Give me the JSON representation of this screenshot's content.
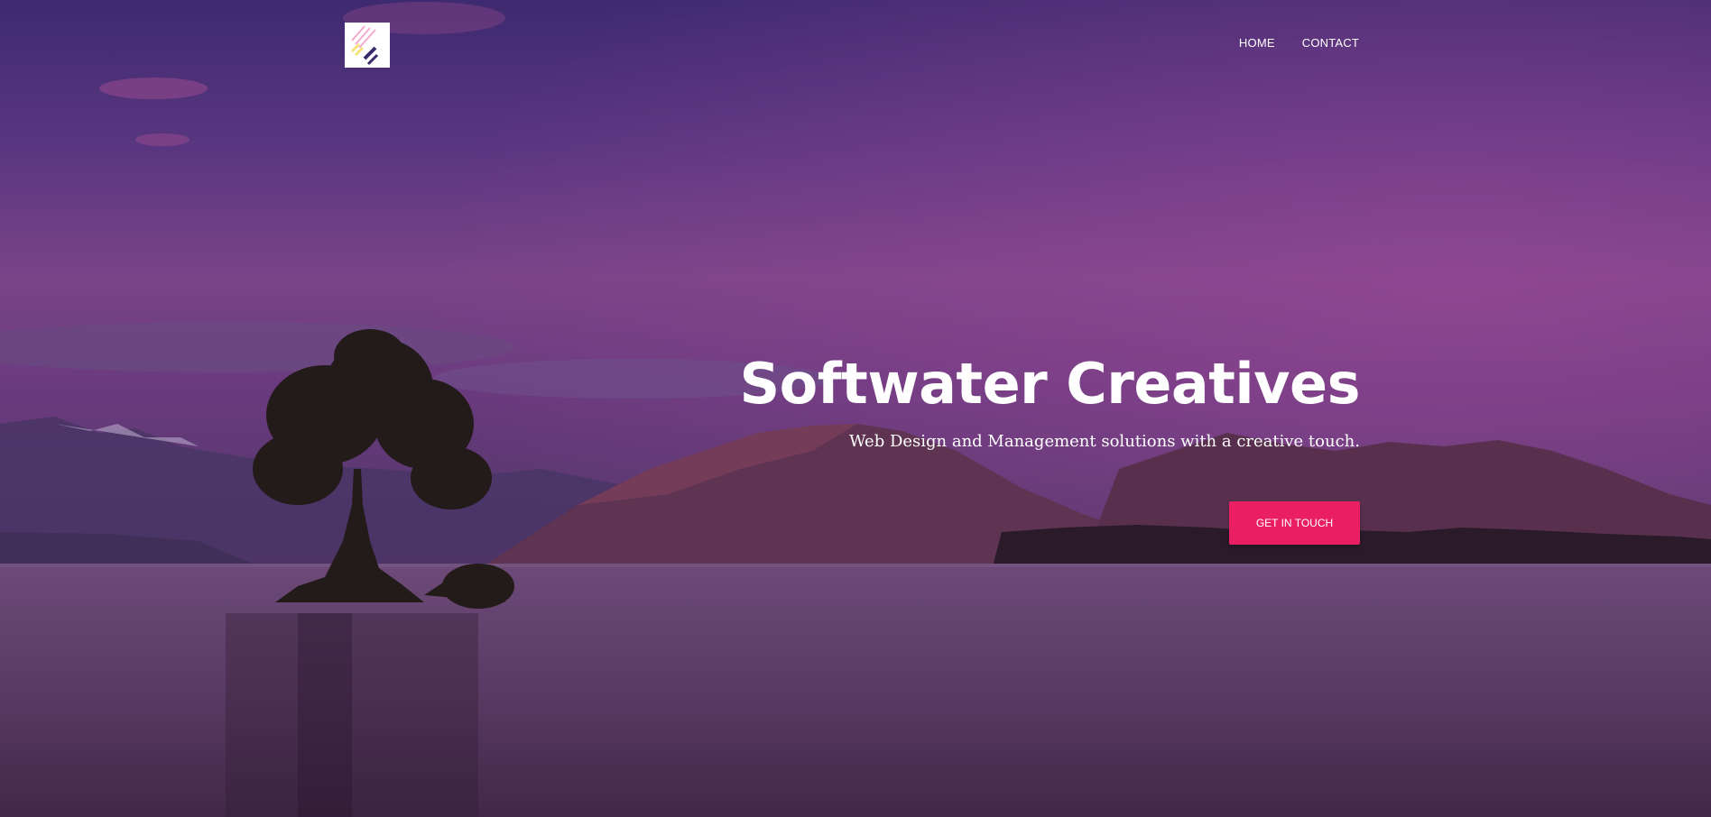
{
  "nav": {
    "logo_alt": "Softwater Creatives logo",
    "items": [
      {
        "label": "HOME"
      },
      {
        "label": "CONTACT"
      }
    ]
  },
  "hero": {
    "title": "Softwater Creatives",
    "subtitle": "Web Design and Management solutions with a creative touch.",
    "cta_label": "GET IN TOUCH"
  },
  "colors": {
    "accent": "#e91e63",
    "overlay": "#5a3680"
  }
}
